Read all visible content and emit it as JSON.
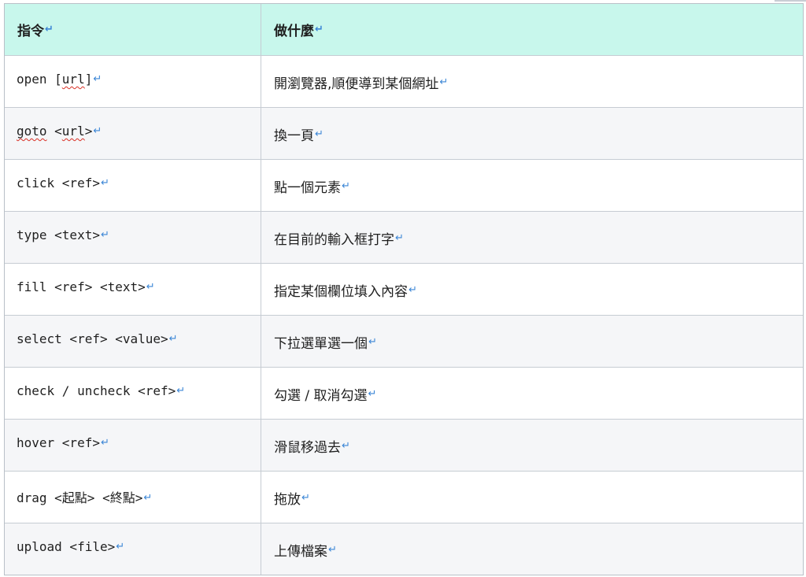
{
  "table": {
    "headers": {
      "command": "指令",
      "action": "做什麼"
    },
    "return_mark": "↵",
    "rows": [
      {
        "cmd_parts": [
          "open [",
          "url",
          "]"
        ],
        "desc": "開瀏覽器,順便導到某個網址"
      },
      {
        "cmd_parts": [
          "goto",
          " <",
          "url",
          ">"
        ],
        "desc": "換一頁"
      },
      {
        "cmd": "click <ref>",
        "desc": "點一個元素"
      },
      {
        "cmd": "type <text>",
        "desc": "在目前的輸入框打字"
      },
      {
        "cmd": "fill <ref> <text>",
        "desc": "指定某個欄位填入內容"
      },
      {
        "cmd": "select <ref> <value>",
        "desc": "下拉選單選一個"
      },
      {
        "cmd": "check / uncheck <ref>",
        "desc": "勾選 / 取消勾選"
      },
      {
        "cmd": "hover <ref>",
        "desc": "滑鼠移過去"
      },
      {
        "cmd": "drag <起點> <終點>",
        "desc": "拖放"
      },
      {
        "cmd": "upload <file>",
        "desc": "上傳檔案"
      }
    ]
  },
  "colors": {
    "header_bg": "#c8f7ec",
    "alt_row_bg": "#f5f6f8",
    "border": "#c6ccd3",
    "return_mark": "#3b86d6"
  }
}
